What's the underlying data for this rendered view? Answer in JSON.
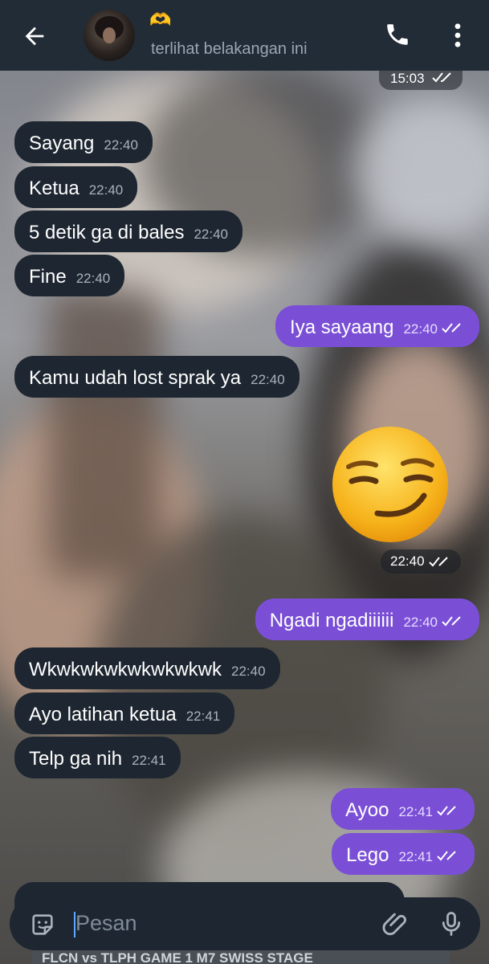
{
  "header": {
    "contact_emoji": "🫶",
    "status": "terlihat belakangan ini",
    "icons": [
      "back-arrow-icon",
      "avatar",
      "phone-icon",
      "more-vertical-icon"
    ]
  },
  "top_chip": {
    "time": "15:03"
  },
  "messages": [
    {
      "side": "in",
      "text": "Sayang",
      "time": "22:40"
    },
    {
      "side": "in",
      "text": "Ketua",
      "time": "22:40"
    },
    {
      "side": "in",
      "text": "5 detik ga di bales",
      "time": "22:40"
    },
    {
      "side": "in",
      "text": "Fine",
      "time": "22:40"
    },
    {
      "side": "out",
      "text": "Iya sayaang",
      "time": "22:40"
    },
    {
      "side": "in",
      "text": "Kamu udah lost sprak ya",
      "time": "22:40"
    },
    {
      "side": "out",
      "text": "😏",
      "time": "22:40"
    },
    {
      "side": "out",
      "text": "Ngadi ngadiiiiii",
      "time": "22:40"
    },
    {
      "side": "in",
      "text": "Wkwkwkwkwkwkwkwk",
      "time": "22:40"
    },
    {
      "side": "in",
      "text": "Ayo latihan ketua",
      "time": "22:41"
    },
    {
      "side": "in",
      "text": "Telp ga nih",
      "time": "22:41"
    },
    {
      "side": "out",
      "text": "Ayoo",
      "time": "22:41"
    },
    {
      "side": "out",
      "text": "Lego",
      "time": "22:41"
    }
  ],
  "input": {
    "placeholder": "Pesan"
  },
  "bottom_preview": "FLCN vs TLPH GAME 1 M7 SWISS STAGE",
  "colors": {
    "header": "#222c37",
    "incoming": "#1e2731",
    "outgoing": "#7a4fd6",
    "link": "#5aa8ff"
  }
}
